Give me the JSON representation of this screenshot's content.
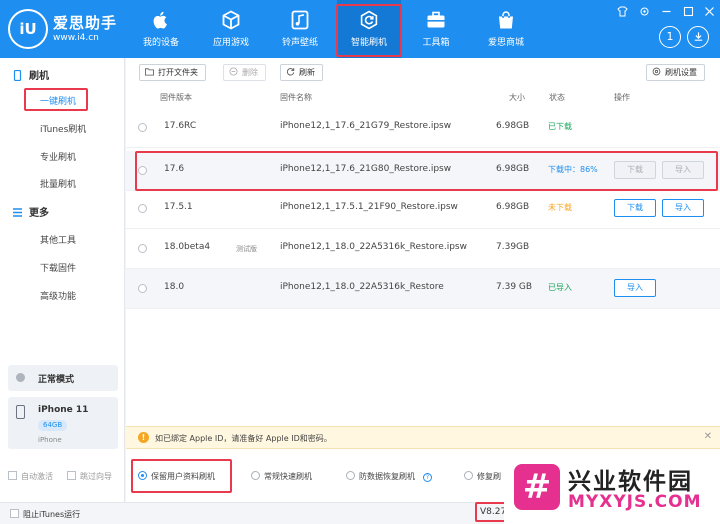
{
  "app": {
    "brand_name": "爱思助手",
    "brand_url": "www.i4.cn",
    "logo_text": "iU",
    "notification_count": "1"
  },
  "nav": {
    "items": [
      {
        "label": "我的设备",
        "icon": "apple-icon"
      },
      {
        "label": "应用游戏",
        "icon": "cube-icon"
      },
      {
        "label": "铃声壁纸",
        "icon": "music-icon"
      },
      {
        "label": "智能刷机",
        "icon": "refresh-icon",
        "active": true
      },
      {
        "label": "工具箱",
        "icon": "toolbox-icon"
      },
      {
        "label": "爱思商城",
        "icon": "bag-icon"
      }
    ]
  },
  "sidebar": {
    "group_flash": "刷机",
    "items_flash": [
      "一键刷机",
      "iTunes刷机",
      "专业刷机",
      "批量刷机"
    ],
    "group_more": "更多",
    "items_more": [
      "其他工具",
      "下载固件",
      "高级功能"
    ],
    "mode_label": "正常模式",
    "device_name": "iPhone 11",
    "device_capacity": "64GB",
    "device_type": "iPhone"
  },
  "toolbar": {
    "open_folder": "打开文件夹",
    "delete": "删除",
    "refresh": "刷新",
    "flash_settings": "刷机设置"
  },
  "table": {
    "headers": {
      "version": "固件版本",
      "name": "固件名称",
      "size": "大小",
      "status": "状态",
      "action": "操作"
    },
    "rows": [
      {
        "version": "17.6RC",
        "tag": "",
        "name": "iPhone12,1_17.6_21G79_Restore.ipsw",
        "size": "6.98GB",
        "status": "已下载",
        "status_color": "#19a55a",
        "buttons": []
      },
      {
        "version": "17.6",
        "tag": "",
        "name": "iPhone12,1_17.6_21G80_Restore.ipsw",
        "size": "6.98GB",
        "status": "下载中：86%",
        "status_color": "#1e8ef0",
        "buttons": [
          "下载",
          "导入"
        ],
        "buttons_disabled": true
      },
      {
        "version": "17.5.1",
        "tag": "",
        "name": "iPhone12,1_17.5.1_21F90_Restore.ipsw",
        "size": "6.98GB",
        "status": "未下载",
        "status_color": "#f5a623",
        "buttons": [
          "下载",
          "导入"
        ]
      },
      {
        "version": "18.0beta4",
        "tag": "测试版",
        "name": "iPhone12,1_18.0_22A5316k_Restore.ipsw",
        "size": "7.39GB",
        "status": "",
        "status_color": "#333333",
        "buttons": []
      },
      {
        "version": "18.0",
        "tag": "",
        "name": "iPhone12,1_18.0_22A5316k_Restore",
        "size": "7.39 GB",
        "status": "已导入",
        "status_color": "#19a55a",
        "buttons": [
          "导入"
        ]
      }
    ]
  },
  "notice": {
    "text": "如已绑定 Apple ID，请准备好 Apple ID和密码。"
  },
  "options": {
    "keep_data": "保留用户资料刷机",
    "quick": "常规快速刷机",
    "anti_recovery": "防数据恢复刷机",
    "repair": "修复刷"
  },
  "left_options": {
    "auto_activate": "自动激活",
    "skip_guide": "跳过向导"
  },
  "statusbar": {
    "block_itunes": "阻止iTunes运行",
    "version": "V8.27"
  },
  "watermark": {
    "title": "兴业软件园",
    "url": "MYXYJS.COM"
  }
}
